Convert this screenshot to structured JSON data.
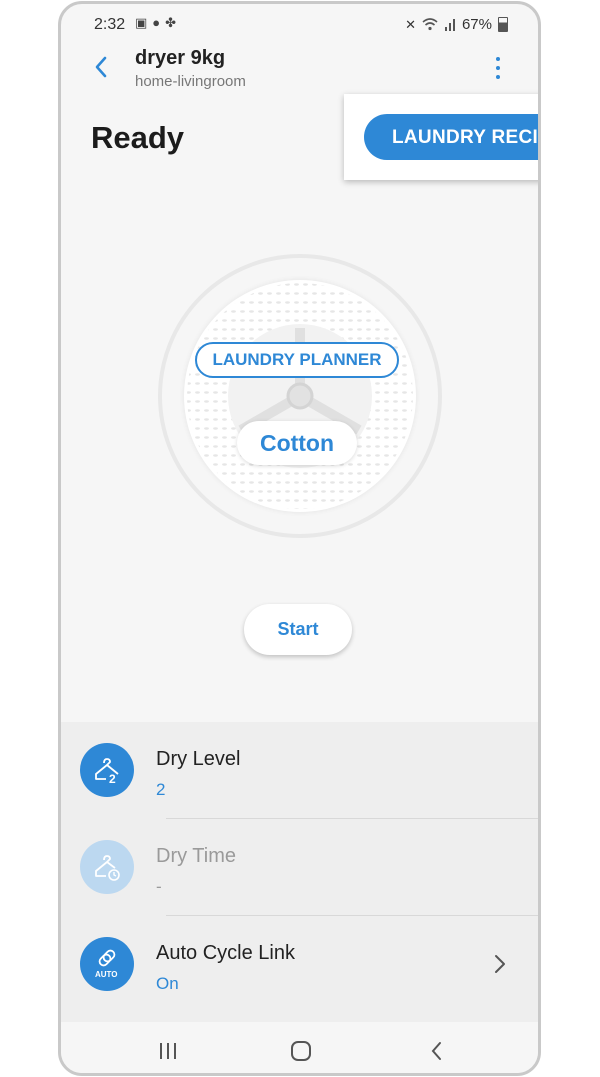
{
  "status": {
    "time": "2:32",
    "battery": "67%",
    "icons": [
      "image-icon",
      "bulb-icon",
      "fan-icon",
      "mute-icon",
      "wifi-icon",
      "signal-icon",
      "battery-icon"
    ]
  },
  "header": {
    "title": "dryer 9kg",
    "subtitle": "home-livingroom"
  },
  "state": "Ready",
  "menu": {
    "item": "LAUNDRY RECIPE"
  },
  "drum": {
    "planner_label": "LAUNDRY PLANNER",
    "cycle": "Cotton"
  },
  "start_label": "Start",
  "settings": [
    {
      "name": "Dry Level",
      "value": "2",
      "icon": "dry-level-icon",
      "enabled": true
    },
    {
      "name": "Dry Time",
      "value": "-",
      "icon": "dry-time-icon",
      "enabled": false
    },
    {
      "name": "Auto Cycle Link",
      "value": "On",
      "icon": "auto-cycle-link-icon",
      "enabled": true
    }
  ],
  "colors": {
    "accent": "#2e88d6",
    "background": "#f6f6f6",
    "settings_bg": "#eeeeee"
  }
}
